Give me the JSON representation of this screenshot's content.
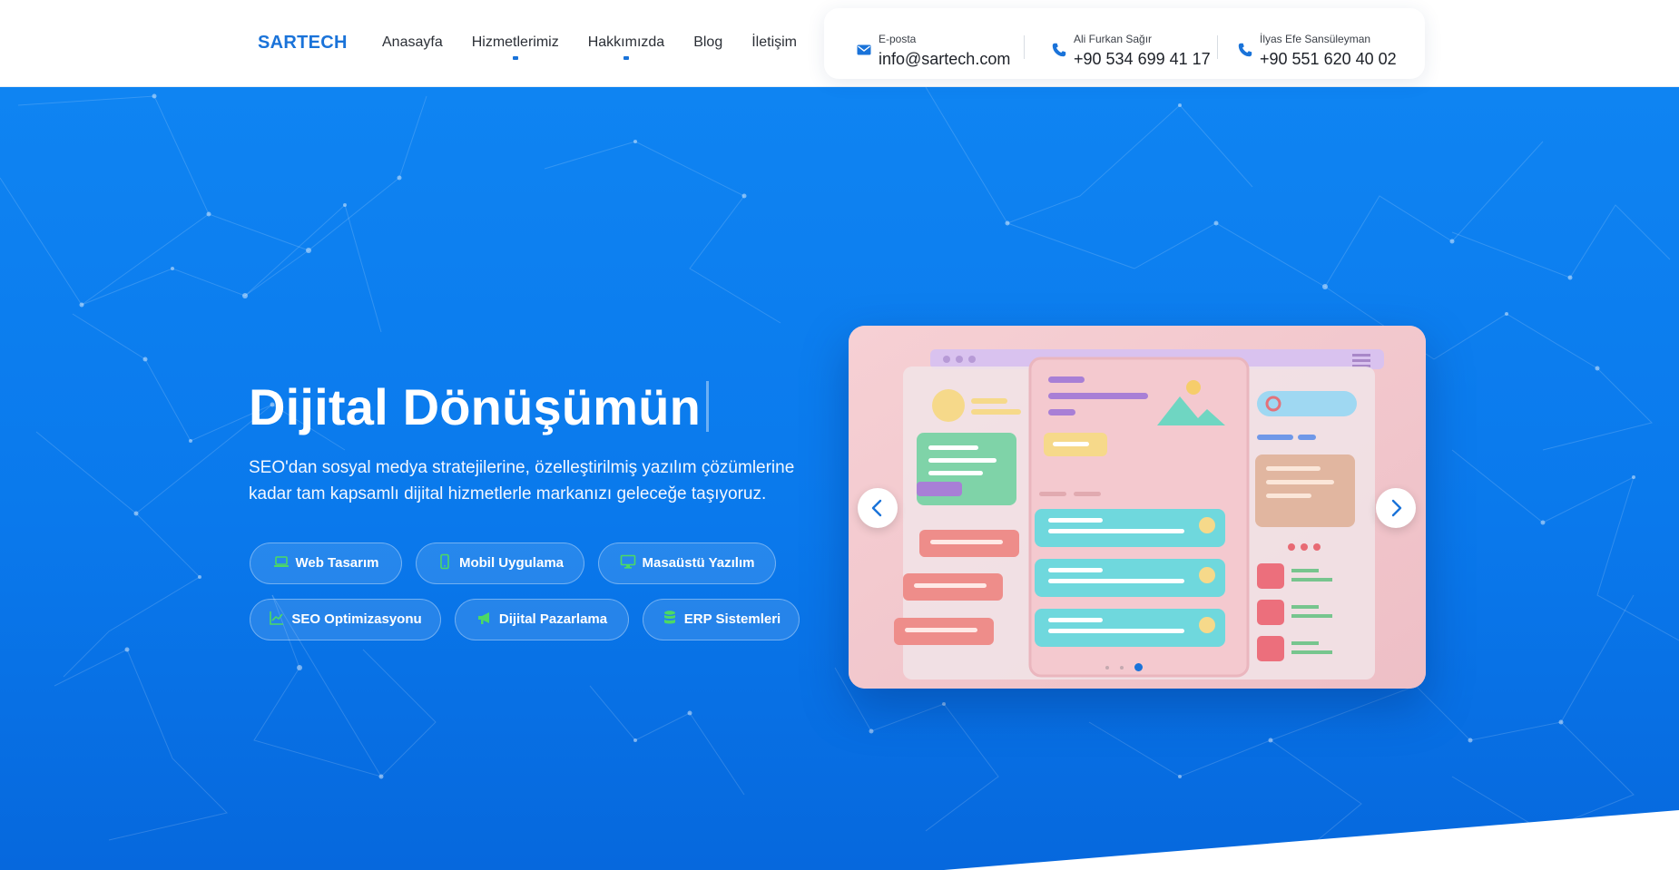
{
  "brand": {
    "name": "SARTECH"
  },
  "nav": {
    "items": [
      "Anasayfa",
      "Hizmetlerimiz",
      "Hakkımızda",
      "Blog",
      "İletişim"
    ]
  },
  "contacts": [
    {
      "label": "E-posta",
      "value": "info@sartech.com",
      "icon": "envelope-icon"
    },
    {
      "label": "Ali Furkan Sağır",
      "value": "+90 534 699 41 17",
      "icon": "phone-icon"
    },
    {
      "label": "İlyas Efe Sansüleyman",
      "value": "+90 551 620 40 02",
      "icon": "phone-icon"
    }
  ],
  "hero": {
    "title": "Dijital Dönüşümün",
    "subtitle": "SEO'dan sosyal medya stratejilerine, özelleştirilmiş yazılım çözümlerine kadar tam kapsamlı dijital hizmetlerle markanızı geleceğe taşıyoruz."
  },
  "services": [
    {
      "label": "Web Tasarım",
      "icon": "laptop-icon"
    },
    {
      "label": "Mobil Uygulama",
      "icon": "mobile-icon"
    },
    {
      "label": "Masaüstü Yazılım",
      "icon": "desktop-icon"
    },
    {
      "label": "SEO Optimizasyonu",
      "icon": "chart-line-icon"
    },
    {
      "label": "Dijital Pazarlama",
      "icon": "megaphone-icon"
    },
    {
      "label": "ERP Sistemleri",
      "icon": "database-icon"
    }
  ],
  "carousel": {
    "slide_count": 3,
    "active_slide": 3,
    "image_subject": "pastel 3D user interface illustration"
  },
  "colors": {
    "brand_blue": "#1a73d9",
    "hero_blue": "#0a79ec",
    "chip_icon_green": "#4cd964"
  }
}
